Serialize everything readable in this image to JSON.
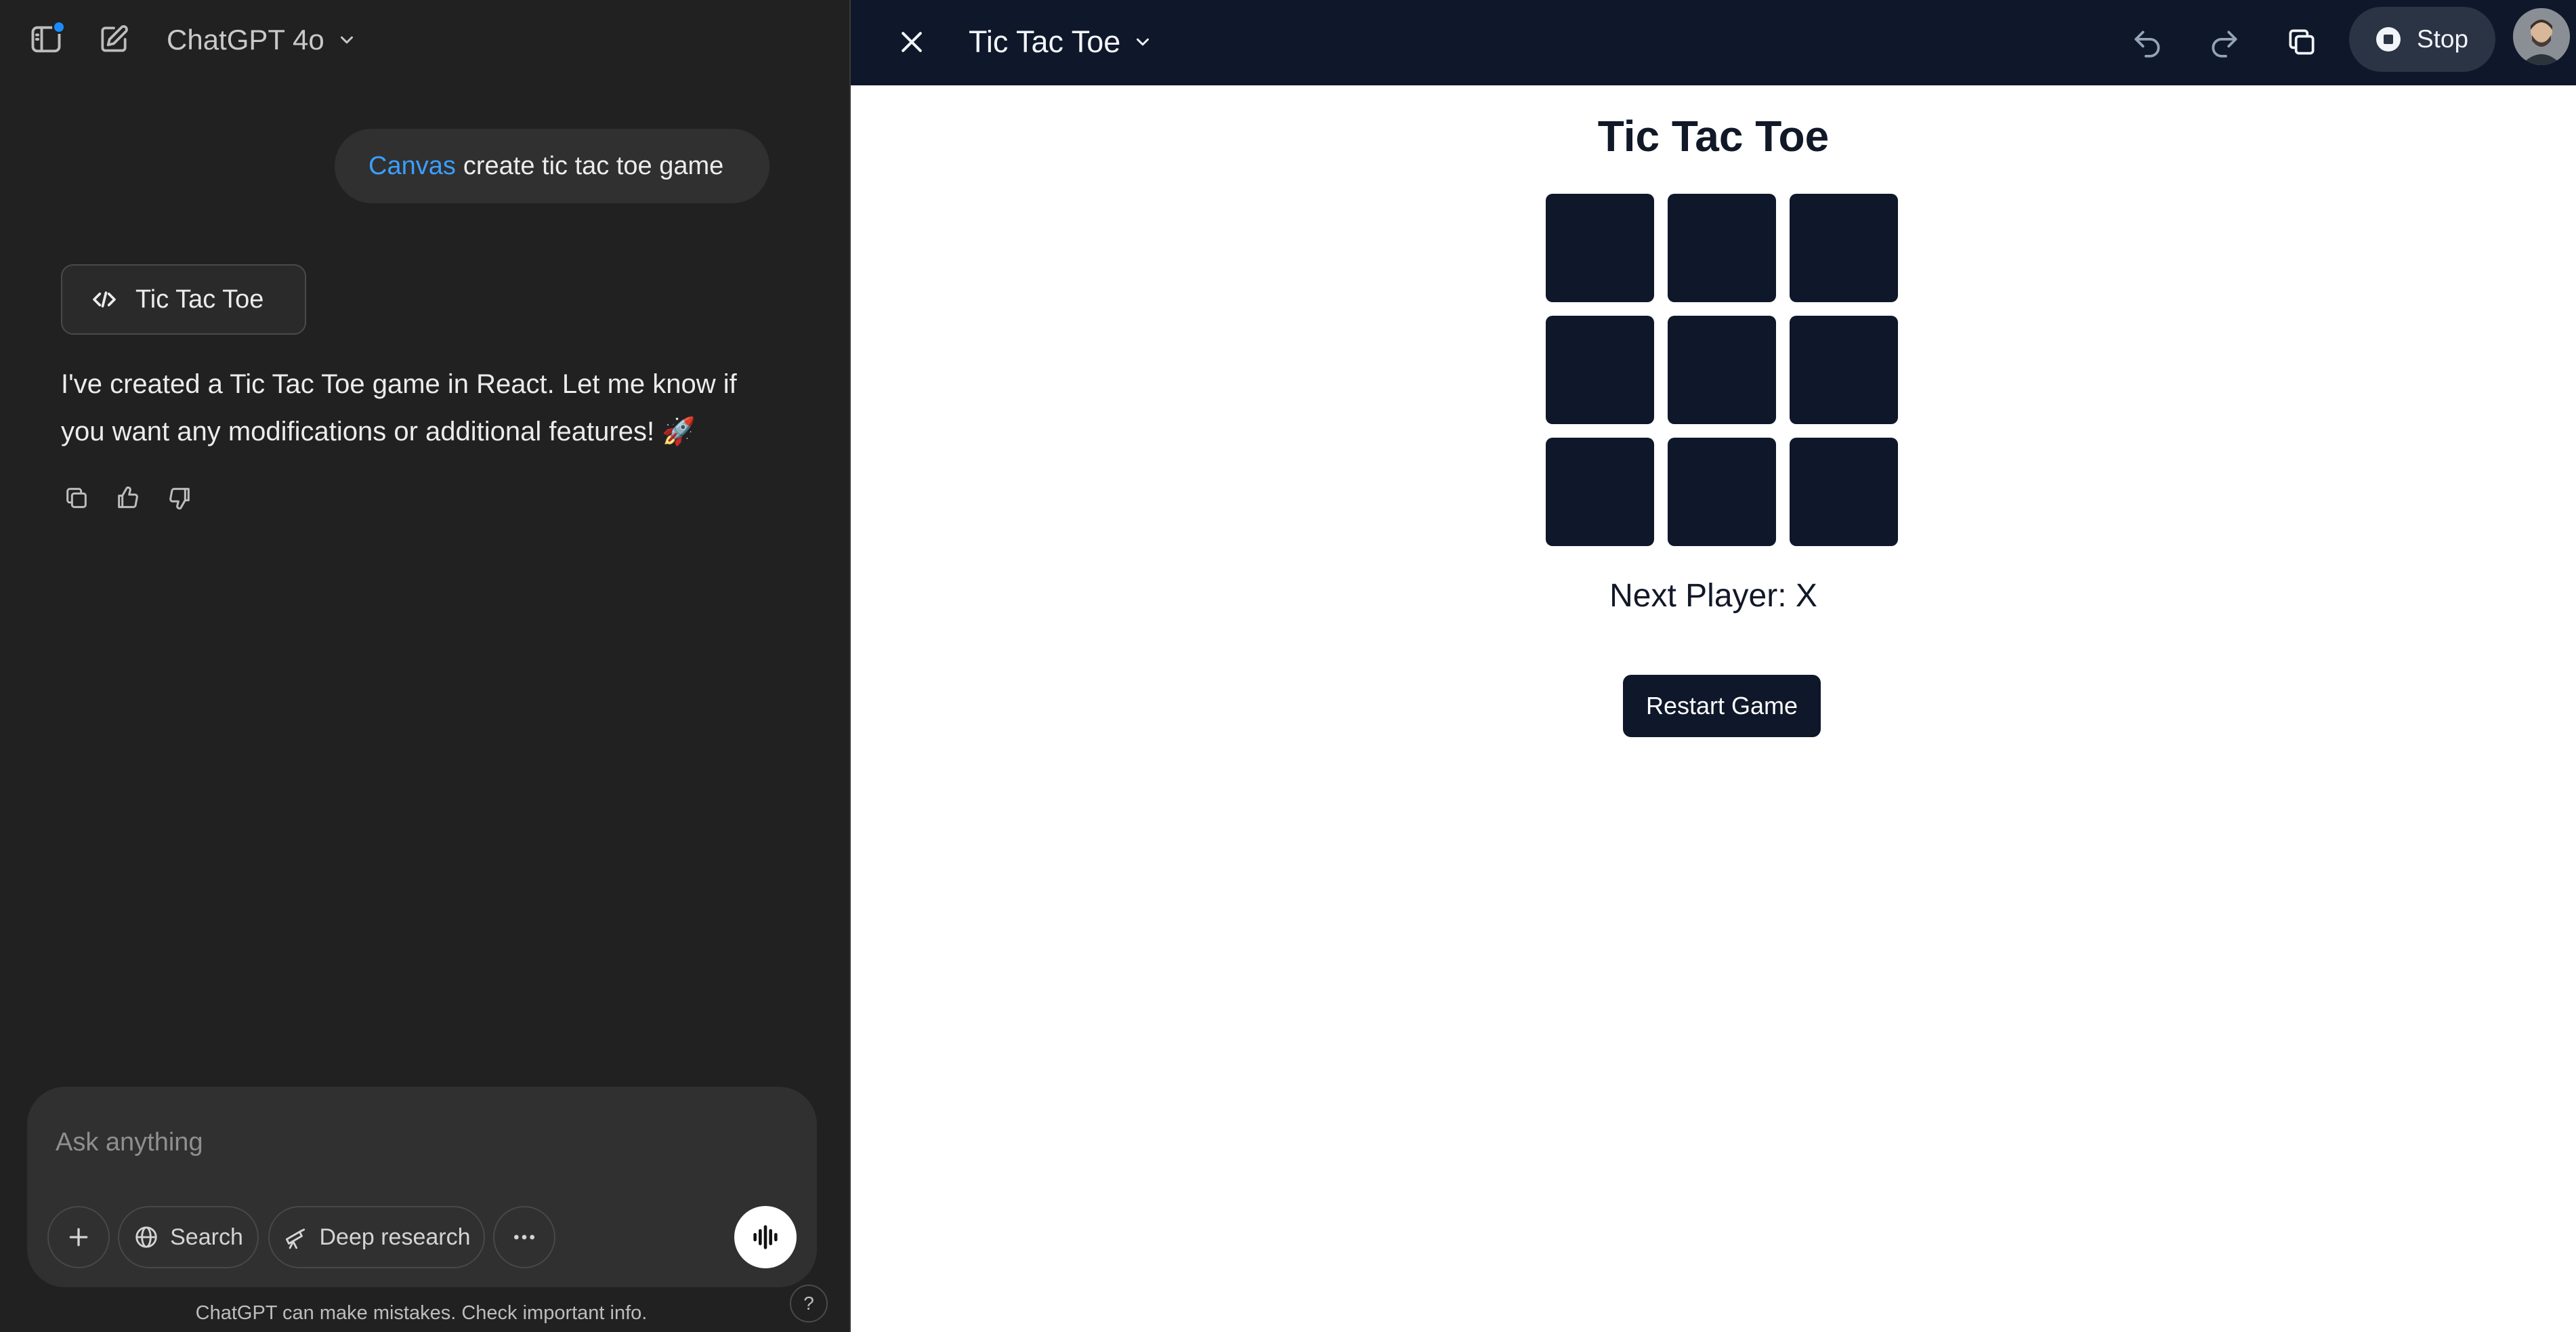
{
  "chat": {
    "model_label": "ChatGPT 4o",
    "user_message": {
      "tag": "Canvas",
      "text": "create tic tac toe game"
    },
    "canvas_chip_label": "Tic Tac Toe",
    "assistant_message": "I've created a Tic Tac Toe game in React. Let me know if you want any modifications or additional features! 🚀",
    "composer": {
      "placeholder": "Ask anything",
      "search_label": "Search",
      "deep_research_label": "Deep research"
    },
    "disclaimer": "ChatGPT can make mistakes. Check important info.",
    "help_label": "?"
  },
  "canvas": {
    "title": "Tic Tac Toe",
    "stop_label": "Stop",
    "game": {
      "heading": "Tic Tac Toe",
      "board": [
        "",
        "",
        "",
        "",
        "",
        "",
        "",
        "",
        ""
      ],
      "status": "Next Player: X",
      "restart_label": "Restart Game"
    }
  },
  "colors": {
    "accent_link": "#3b9eff",
    "notification_dot": "#1a8cff",
    "canvas_dark": "#0f172a",
    "chat_bg": "#212121"
  }
}
